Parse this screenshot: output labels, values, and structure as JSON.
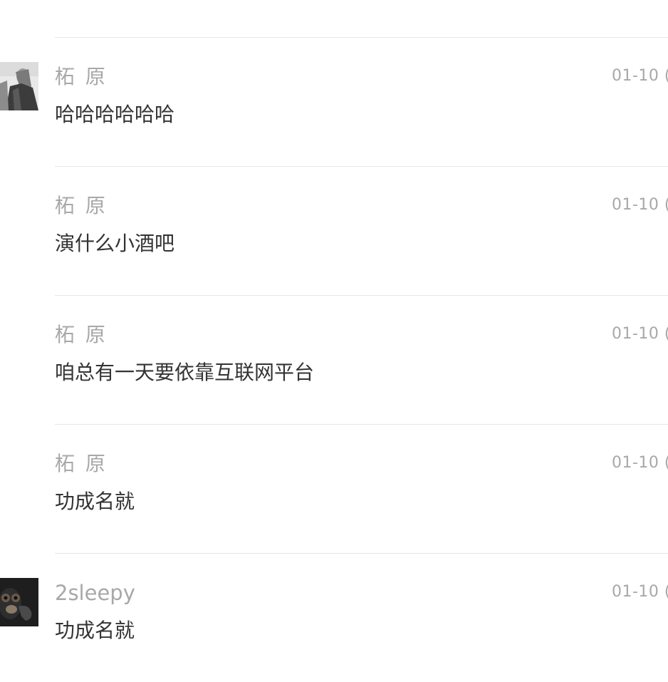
{
  "comments": [
    {
      "author": "柘 原",
      "time": "01-10 (",
      "text": "哈哈哈哈哈哈",
      "avatar": "grey-figure-avatar"
    },
    {
      "author": "柘 原",
      "time": "01-10 (",
      "text": "演什么小酒吧"
    },
    {
      "author": "柘 原",
      "time": "01-10 (",
      "text": "咱总有一天要依靠互联网平台"
    },
    {
      "author": "柘 原",
      "time": "01-10 (",
      "text": "功成名就"
    },
    {
      "author": "2sleepy",
      "time": "01-10 (",
      "text": "功成名就",
      "avatar": "monkey-avatar"
    }
  ]
}
